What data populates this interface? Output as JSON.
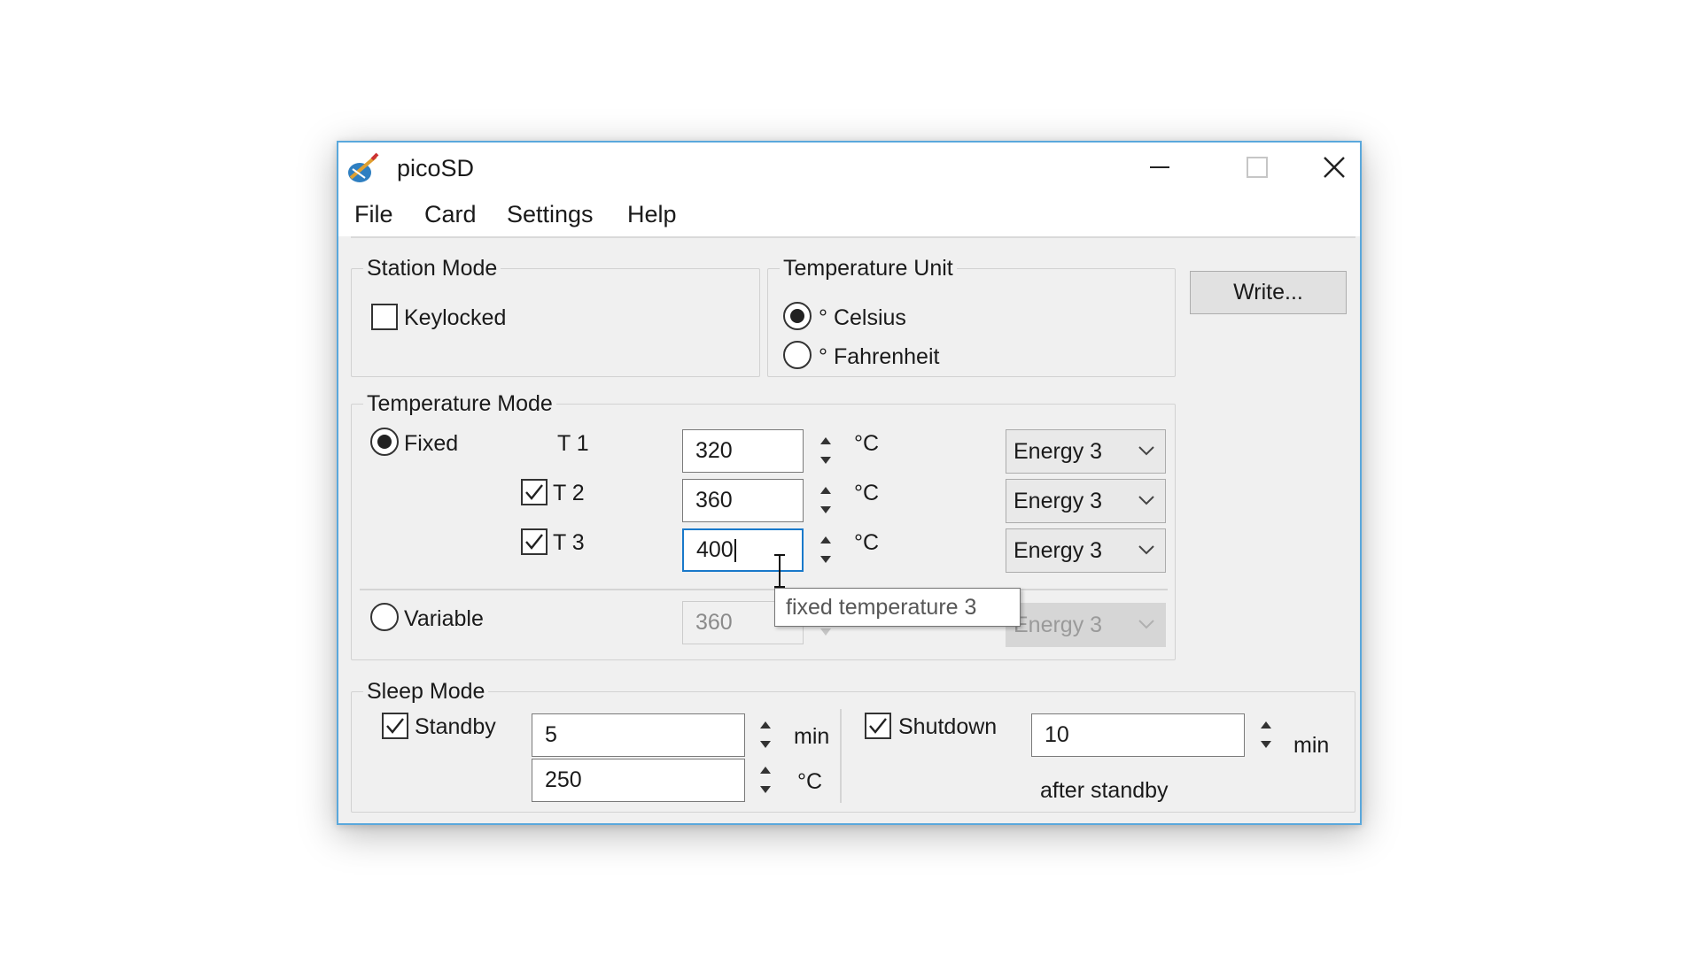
{
  "window": {
    "title": "picoSD"
  },
  "menu": {
    "file": "File",
    "card": "Card",
    "settings": "Settings",
    "help": "Help"
  },
  "station_mode": {
    "label": "Station Mode",
    "keylocked_label": "Keylocked",
    "keylocked_checked": false
  },
  "temperature_unit": {
    "label": "Temperature Unit",
    "celsius_label": "° Celsius",
    "fahrenheit_label": "° Fahrenheit",
    "selected": "celsius"
  },
  "write_button": "Write...",
  "temperature_mode": {
    "label": "Temperature Mode",
    "fixed_label": "Fixed",
    "variable_label": "Variable",
    "selected": "fixed",
    "rows": [
      {
        "label": "T 1",
        "value": "320",
        "unit": "°C",
        "energy": "Energy 3",
        "has_checkbox": false
      },
      {
        "label": "T 2",
        "value": "360",
        "unit": "°C",
        "energy": "Energy 3",
        "has_checkbox": true,
        "checked": true
      },
      {
        "label": "T 3",
        "value": "400",
        "unit": "°C",
        "energy": "Energy 3",
        "has_checkbox": true,
        "checked": true
      }
    ],
    "variable": {
      "value": "360",
      "energy": "Energy 3"
    }
  },
  "tooltip": "fixed temperature 3",
  "sleep_mode": {
    "label": "Sleep Mode",
    "standby_label": "Standby",
    "standby_checked": true,
    "standby_minutes": "5",
    "standby_minutes_unit": "min",
    "standby_temp": "250",
    "standby_temp_unit": "°C",
    "shutdown_label": "Shutdown",
    "shutdown_checked": true,
    "shutdown_minutes": "10",
    "shutdown_minutes_unit": "min",
    "after_standby_label": "after standby"
  }
}
